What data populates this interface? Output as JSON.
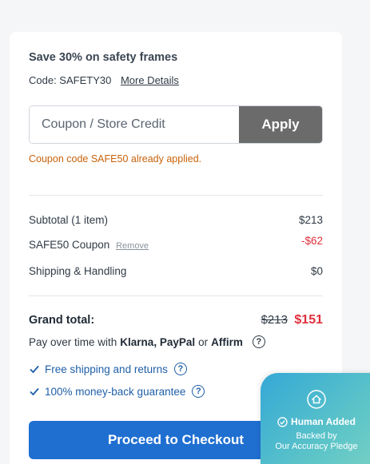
{
  "promo": {
    "title": "Save 30% on safety frames",
    "code_text": "Code: SAFETY30",
    "details_link": "More Details"
  },
  "coupon": {
    "placeholder": "Coupon / Store Credit",
    "apply_label": "Apply",
    "message": "Coupon code SAFE50 already applied."
  },
  "summary": {
    "subtotal_label": "Subtotal (1 item)",
    "subtotal_value": "$213",
    "coupon_label": "SAFE50 Coupon",
    "remove_label": "Remove",
    "coupon_value": "-$62",
    "shipping_label": "Shipping & Handling",
    "shipping_value": "$0"
  },
  "grand_total": {
    "label": "Grand total:",
    "old_price": "$213",
    "new_price": "$151"
  },
  "pay_over_time": {
    "prefix": "Pay over time with",
    "providers": "Klarna, PayPal",
    "or": "or",
    "affirm": "Affirm"
  },
  "perks": [
    "Free shipping and returns",
    "100% money-back guarantee"
  ],
  "checkout": {
    "label": "Proceed to Checkout"
  },
  "badge": {
    "title": "Human Added",
    "line1": "Backed by",
    "line2": "Our Accuracy Pledge"
  },
  "colors": {
    "accent_blue": "#1f6fd1",
    "discount_red": "#e0303e",
    "warning_orange": "#c8620a",
    "perk_blue": "#1f5fa8",
    "apply_gray": "#6b6b6b"
  }
}
